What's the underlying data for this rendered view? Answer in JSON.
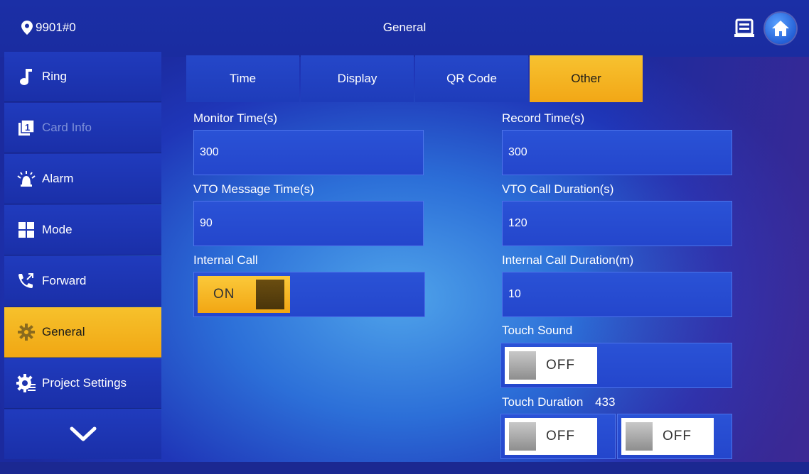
{
  "header": {
    "location": "9901#0",
    "title": "General"
  },
  "sidebar": {
    "items": [
      {
        "label": "Ring",
        "icon": "music-note-icon"
      },
      {
        "label": "Card Info",
        "icon": "card-icon"
      },
      {
        "label": "Alarm",
        "icon": "alarm-siren-icon"
      },
      {
        "label": "Mode",
        "icon": "grid-icon"
      },
      {
        "label": "Forward",
        "icon": "call-forward-icon"
      },
      {
        "label": "General",
        "icon": "gear-icon"
      },
      {
        "label": "Project Settings",
        "icon": "settings-gear-icon"
      }
    ]
  },
  "tabs": [
    {
      "label": "Time"
    },
    {
      "label": "Display"
    },
    {
      "label": "QR Code"
    },
    {
      "label": "Other"
    }
  ],
  "form": {
    "monitor_time": {
      "label": "Monitor Time(s)",
      "value": "300"
    },
    "record_time": {
      "label": "Record Time(s)",
      "value": "300"
    },
    "vto_message_time": {
      "label": "VTO Message Time(s)",
      "value": "90"
    },
    "vto_call_duration": {
      "label": "VTO Call Duration(s)",
      "value": "120"
    },
    "internal_call": {
      "label": "Internal Call",
      "state": "ON"
    },
    "internal_call_duration": {
      "label": "Internal Call Duration(m)",
      "value": "10"
    },
    "touch_sound": {
      "label": "Touch Sound",
      "state": "OFF"
    },
    "touch_duration": {
      "label": "Touch Duration",
      "value": "433",
      "state_1": "OFF",
      "state_2": "OFF"
    }
  },
  "colors": {
    "accent": "#f4b41e",
    "background": "#2446cc",
    "topbar": "#1b2fa6"
  }
}
